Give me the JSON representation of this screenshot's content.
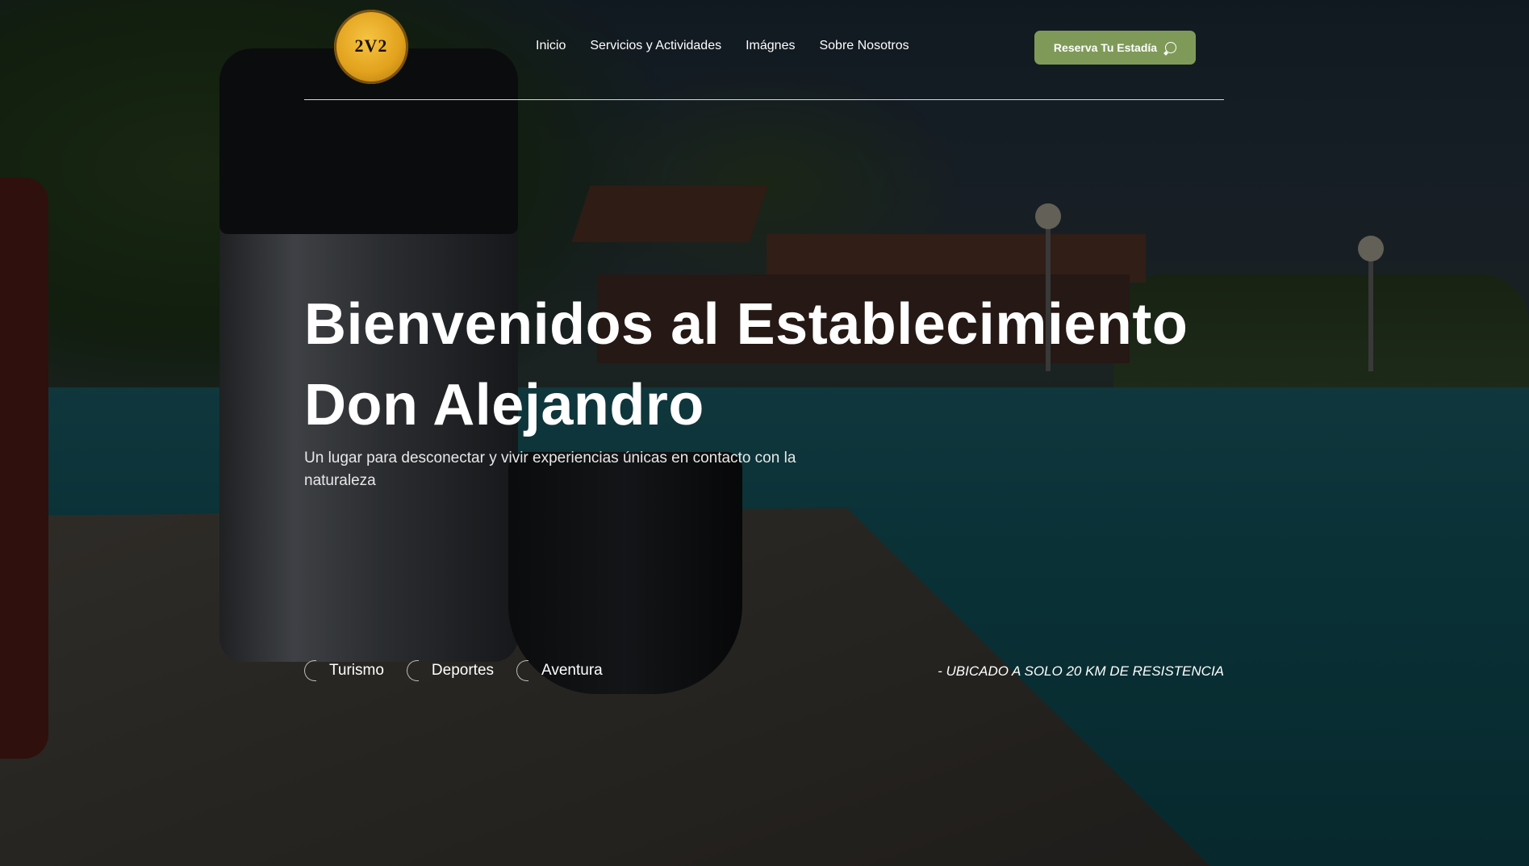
{
  "header": {
    "logo_alt": "Establecimiento Don Alejandro",
    "logo_mark": "2V2",
    "nav": [
      {
        "label": "Inicio"
      },
      {
        "label": "Servicios y Actividades"
      },
      {
        "label": "Imágnes"
      },
      {
        "label": "Sobre Nosotros"
      }
    ],
    "cta_label": "Reserva Tu Estadía",
    "cta_icon": "whatsapp-icon",
    "accent_color": "#7f9a58"
  },
  "hero": {
    "title_line1": "Bienvenidos al Establecimiento",
    "title_line2": "Don Alejandro",
    "subtitle": "Un lugar para desconectar y vivir experiencias únicas en contacto con la naturaleza",
    "tags": [
      {
        "label": "Turismo"
      },
      {
        "label": "Deportes"
      },
      {
        "label": "Aventura"
      }
    ],
    "location": "- UBICADO A SOLO 20 KM DE RESISTENCIA"
  }
}
